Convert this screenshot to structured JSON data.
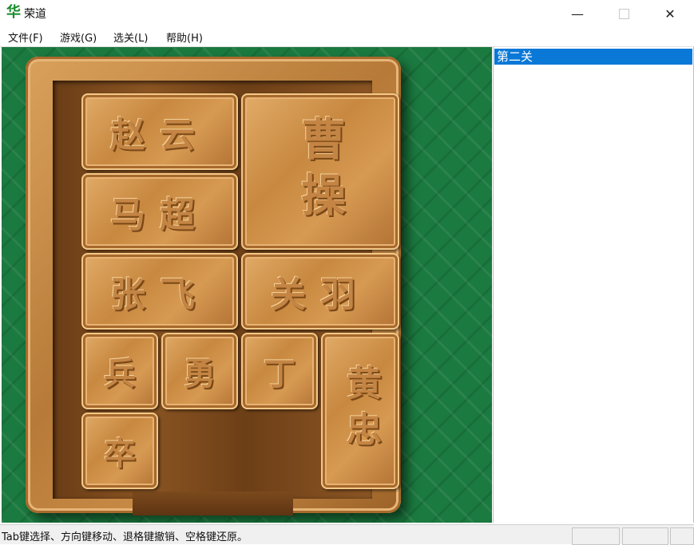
{
  "window": {
    "icon_glyph": "华",
    "title": "荣道",
    "minimize_glyph": "—",
    "close_glyph": "✕"
  },
  "menu": {
    "file": "文件(F)",
    "game": "游戏(G)",
    "level": "选关(L)",
    "help": "帮助(H)"
  },
  "board": {
    "pieces": {
      "zhaoyun": "赵云",
      "caocao": "曹操",
      "machao": "马超",
      "zhangfei": "张飞",
      "guanyu": "关羽",
      "bing": "兵",
      "yong": "勇",
      "ding": "丁",
      "huangzhong": "黄忠",
      "zu": "卒"
    },
    "colors": {
      "felt": "#1b7a3f",
      "wood": "#c88840"
    }
  },
  "levels": {
    "items": [
      "第二关"
    ],
    "selected_index": 0,
    "highlight_color": "#0a78d7"
  },
  "status": {
    "text": "Tab键选择、方向键移动、退格键撤销、空格键还原。"
  }
}
